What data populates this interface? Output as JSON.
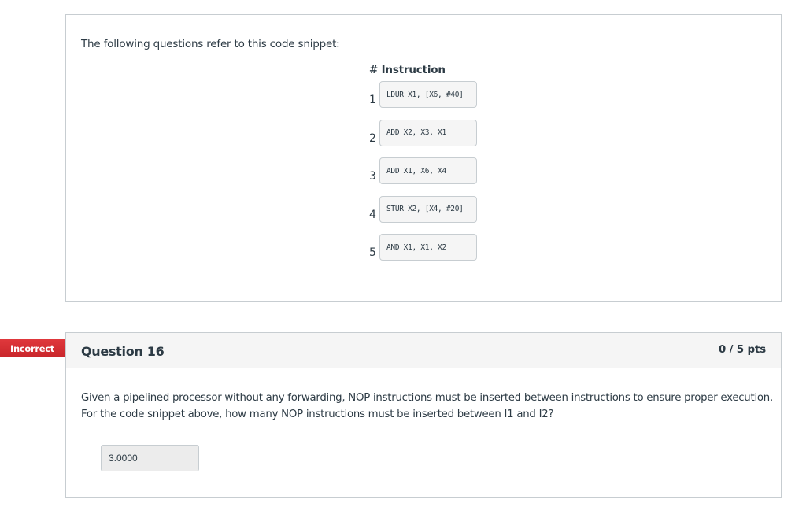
{
  "snippet": {
    "intro": "The following questions refer to this code snippet:",
    "table_header": "# Instruction",
    "instructions": [
      {
        "num": "1",
        "code": "LDUR X1, [X6, #40]"
      },
      {
        "num": "2",
        "code": "ADD X2, X3, X1"
      },
      {
        "num": "3",
        "code": "ADD X1, X6, X4"
      },
      {
        "num": "4",
        "code": "STUR X2, [X4, #20]"
      },
      {
        "num": "5",
        "code": "AND X1, X1, X2"
      }
    ]
  },
  "question": {
    "status": "Incorrect",
    "status_color": "#d22f33",
    "title": "Question 16",
    "points": "0 / 5 pts",
    "text_line1": "Given a pipelined processor without any forwarding, NOP instructions must be inserted between instructions to ensure proper execution.",
    "text_line2": "For the code snippet above, how many NOP instructions must be inserted between I1 and I2?",
    "answer_value": "3.0000"
  }
}
